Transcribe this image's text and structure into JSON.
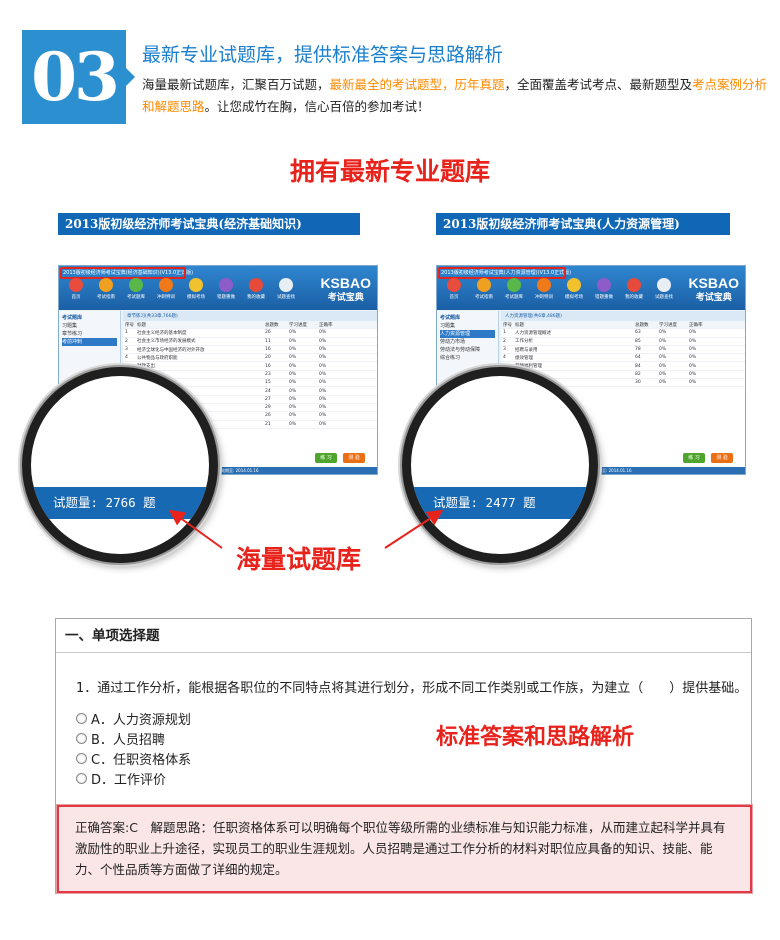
{
  "section": {
    "number": "03",
    "title": "最新专业试题库，提供标准答案与思路解析",
    "desc_parts": [
      {
        "text": "海量最新试题库，汇聚百万试题，",
        "highlight": false
      },
      {
        "text": "最新最全的考试题型，历年真题",
        "highlight": true
      },
      {
        "text": "，全面覆盖考试考点、最新题型及",
        "highlight": false
      },
      {
        "text": "考点案例分析和解题思路",
        "highlight": true
      },
      {
        "text": "。让您成竹在胸，信心百倍的参加考试！",
        "highlight": false
      }
    ]
  },
  "headline_bank": "拥有最新专业题库",
  "headline_mass": "海量试题库",
  "headline_answer": "标准答案和思路解析",
  "screenshots": [
    {
      "title": "2013版初级经济师考试宝典(经济基础知识)",
      "count_text": "试题量: 2766 题",
      "app_caption": "2013版初级经济师考试宝典(经济基础知识)(V13.0正式版)",
      "list_header": "章节练习(共33章,766题)",
      "nav": [
        "考试题库",
        "习题集",
        "章节练习",
        "考前冲刺"
      ],
      "columns": [
        "序号",
        "标题",
        "总题数",
        "学习进度",
        "正确率"
      ],
      "rows": [
        [
          "1",
          "社会主义经济的基本制度",
          "26",
          "0%",
          "0%"
        ],
        [
          "2",
          "社会主义市场经济的发展模式",
          "11",
          "0%",
          "0%"
        ],
        [
          "3",
          "经济全球化与中国经济的对外开放",
          "16",
          "0%",
          "0%"
        ],
        [
          "4",
          "公共物品与政府职能",
          "20",
          "0%",
          "0%"
        ],
        [
          "5",
          "财政支出",
          "16",
          "0%",
          "0%"
        ],
        [
          "6",
          "财政收入",
          "23",
          "0%",
          "0%"
        ],
        [
          "7",
          "税收基本制度",
          "15",
          "0%",
          "0%"
        ],
        [
          "8",
          "政府预算制度",
          "24",
          "0%",
          "0%"
        ],
        [
          "9",
          "货币职能",
          "27",
          "0%",
          "0%"
        ],
        [
          "10",
          "金融机构",
          "29",
          "0%",
          "0%"
        ],
        [
          "11",
          "货币政策",
          "26",
          "0%",
          "0%"
        ],
        [
          "12",
          "银行业务",
          "21",
          "0%",
          "0%"
        ]
      ]
    },
    {
      "title": "2013版初级经济师考试宝典(人力资源管理)",
      "count_text": "试题量: 2477 题",
      "app_caption": "2013版初级经济师考试宝典(人力资源管理)(V13.0正式版)",
      "list_header": "人力资源管理(共6章,486题)",
      "nav": [
        "考试题库",
        "习题集",
        "人力资源管理",
        "劳动力市场",
        "劳动法与劳动保障",
        "综合练习"
      ],
      "columns": [
        "序号",
        "标题",
        "总题数",
        "学习进度",
        "正确率"
      ],
      "rows": [
        [
          "1",
          "人力资源管理概述",
          "63",
          "0%",
          "0%"
        ],
        [
          "2",
          "工作分析",
          "85",
          "0%",
          "0%"
        ],
        [
          "3",
          "招聘与录用",
          "78",
          "0%",
          "0%"
        ],
        [
          "4",
          "绩效管理",
          "64",
          "0%",
          "0%"
        ],
        [
          "5",
          "薪酬福利管理",
          "84",
          "0%",
          "0%"
        ],
        [
          "6",
          "培训与开发",
          "82",
          "0%",
          "0%"
        ],
        [
          "7",
          "员工关系管理",
          "30",
          "0%",
          "0%"
        ]
      ]
    }
  ],
  "app": {
    "logo_main": "KSBAO",
    "logo_sub": "考试宝典",
    "toolbar": [
      "首页",
      "考试指南",
      "考试题库",
      "冲刺特训",
      "模拟考场",
      "错题重做",
      "我的收藏",
      "试题查找"
    ],
    "btn_practice": "练 习",
    "btn_exam": "测 验",
    "status": "软件版本: V13.0 试用有效期至: 2014.01.16"
  },
  "exam": {
    "section_title": "一、单项选择题",
    "question": "1．通过工作分析，能根据各职位的不同特点将其进行划分，形成不同工作类别或工作族，为建立（　　）提供基础。",
    "options": [
      {
        "key": "A",
        "text": "A．人力资源规划"
      },
      {
        "key": "B",
        "text": "B．人员招聘"
      },
      {
        "key": "C",
        "text": "C．任职资格体系"
      },
      {
        "key": "D",
        "text": "D．工作评价"
      }
    ],
    "answer_label": "正确答案:C　解题思路：",
    "answer_text": "任职资格体系可以明确每个职位等级所需的业绩标准与知识能力标准，从而建立起科学并具有激励性的职业上升途径，实现员工的职业生涯规划。人员招聘是通过工作分析的材料对职位应具备的知识、技能、能力、个性品质等方面做了详细的规定。"
  },
  "colors": {
    "accent_blue": "#2c8fcf",
    "title_blue": "#1a7fcf",
    "highlight_orange": "#ff8a00",
    "headline_red": "#e8231c"
  }
}
